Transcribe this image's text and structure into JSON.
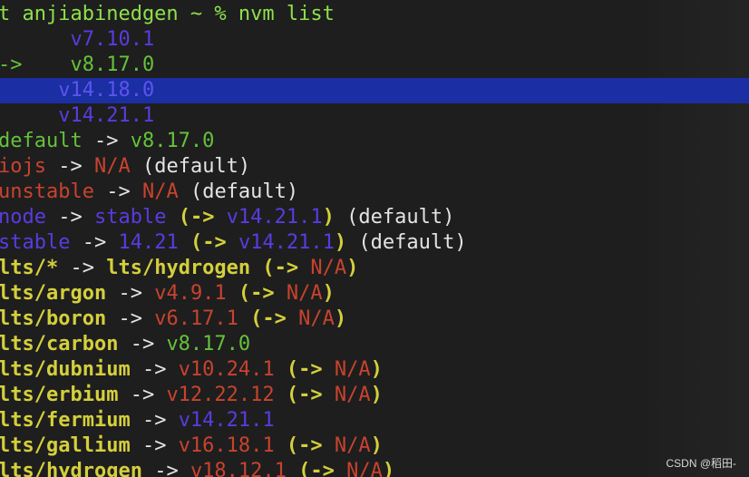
{
  "terminal": {
    "prompt_line": "t anjiabinedgen ~ % nvm list",
    "versions": [
      {
        "marker": "  ",
        "version": "    v7.10.1"
      },
      {
        "marker": "->",
        "version": "    v8.17.0"
      },
      {
        "marker": "  ",
        "version": "   v14.18.0"
      },
      {
        "marker": "  ",
        "version": "   v14.21.1"
      }
    ],
    "aliases": {
      "default": {
        "name": "default",
        "arrow": " -> ",
        "target": "v8.17.0"
      },
      "iojs": {
        "name": "iojs",
        "arrow": " -> ",
        "target": "N/A",
        "suffix": " (default)"
      },
      "unstable": {
        "name": "unstable",
        "arrow": " -> ",
        "target": "N/A",
        "suffix": " (default)"
      },
      "node": {
        "name": "node",
        "arrow": " -> ",
        "target": "stable",
        "paren_open": " (-> ",
        "resolved": "v14.21.1",
        "paren_close": ")",
        "suffix": " (default)"
      },
      "stable": {
        "name": "stable",
        "arrow": " -> ",
        "target": "14.21",
        "paren_open": " (-> ",
        "resolved": "v14.21.1",
        "paren_close": ")",
        "suffix": " (default)"
      },
      "lts_star": {
        "name": "lts/*",
        "arrow": " -> ",
        "target": "lts/hydrogen",
        "paren_open": " (-> ",
        "resolved": "N/A",
        "paren_close": ")"
      },
      "argon": {
        "name": "lts/argon",
        "arrow": " -> ",
        "target": "v4.9.1",
        "paren_open": " (-> ",
        "resolved": "N/A",
        "paren_close": ")"
      },
      "boron": {
        "name": "lts/boron",
        "arrow": " -> ",
        "target": "v6.17.1",
        "paren_open": " (-> ",
        "resolved": "N/A",
        "paren_close": ")"
      },
      "carbon": {
        "name": "lts/carbon",
        "arrow": " -> ",
        "target": "v8.17.0"
      },
      "dubnium": {
        "name": "lts/dubnium",
        "arrow": " -> ",
        "target": "v10.24.1",
        "paren_open": " (-> ",
        "resolved": "N/A",
        "paren_close": ")"
      },
      "erbium": {
        "name": "lts/erbium",
        "arrow": " -> ",
        "target": "v12.22.12",
        "paren_open": " (-> ",
        "resolved": "N/A",
        "paren_close": ")"
      },
      "fermium": {
        "name": "lts/fermium",
        "arrow": " -> ",
        "target": "v14.21.1"
      },
      "gallium": {
        "name": "lts/gallium",
        "arrow": " -> ",
        "target": "v16.18.1",
        "paren_open": " (-> ",
        "resolved": "N/A",
        "paren_close": ")"
      },
      "hydrogen": {
        "name": "lts/hydrogen",
        "arrow": " -> ",
        "target": "v18.12.1",
        "paren_open": " (-> ",
        "resolved": "N/A",
        "paren_close": ")"
      }
    }
  },
  "watermark": "CSDN @稻田-",
  "colors": {
    "background": "#1e1e1e",
    "green": "#65c23a",
    "purple": "#5a3be0",
    "red": "#c8432e",
    "white": "#e4e4e4",
    "yellow": "#d4cf3c",
    "selection": "#1c2ea3"
  }
}
